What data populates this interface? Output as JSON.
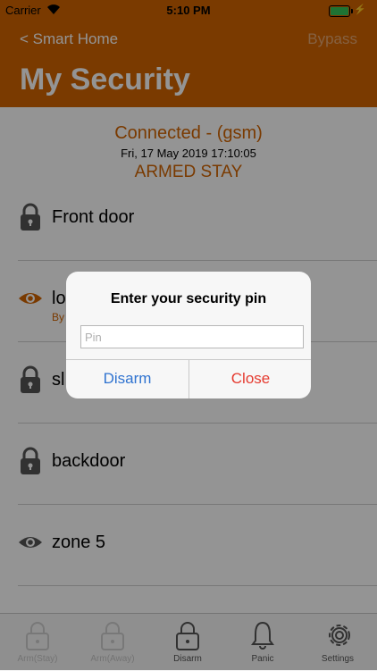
{
  "status_bar": {
    "carrier": "Carrier",
    "time": "5:10 PM"
  },
  "nav": {
    "back_label": "< Smart Home",
    "bypass_label": "Bypass",
    "title": "My Security"
  },
  "connection": {
    "status": "Connected - (gsm)",
    "date": "Fri, 17 May 2019 17:10:05",
    "mode": "ARMED STAY"
  },
  "zones": [
    {
      "name": "Front door",
      "icon": "lock-icon"
    },
    {
      "name": "lo",
      "sub": "By",
      "icon": "eye-icon",
      "icon_color": "#d26400"
    },
    {
      "name": "sl",
      "icon": "lock-icon"
    },
    {
      "name": "backdoor",
      "icon": "lock-icon"
    },
    {
      "name": "zone 5",
      "icon": "eye-icon",
      "icon_color": "#555555"
    }
  ],
  "tabs": [
    {
      "label": "Arm(Stay)",
      "icon": "lock-icon",
      "enabled": false
    },
    {
      "label": "Arm(Away)",
      "icon": "lock-icon",
      "enabled": false
    },
    {
      "label": "Disarm",
      "icon": "unlock-icon",
      "enabled": true
    },
    {
      "label": "Panic",
      "icon": "bell-icon",
      "enabled": true
    },
    {
      "label": "Settings",
      "icon": "gear-icon",
      "enabled": true
    }
  ],
  "dialog": {
    "title": "Enter your security pin",
    "pin_placeholder": "Pin",
    "disarm_label": "Disarm",
    "close_label": "Close"
  },
  "colors": {
    "brand": "#d26400",
    "accent_blue": "#2f73d0",
    "danger_red": "#e53a2f"
  }
}
